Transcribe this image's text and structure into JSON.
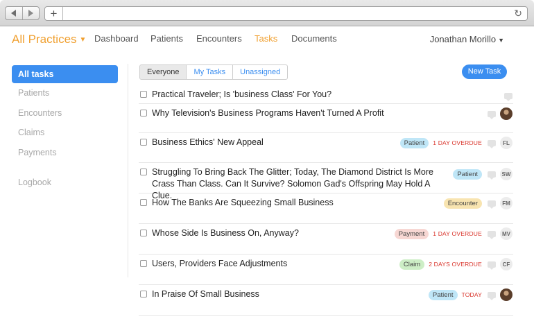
{
  "browser": {
    "url": ""
  },
  "nav": {
    "brand": "All Practices",
    "links": [
      "Dashboard",
      "Patients",
      "Encounters",
      "Tasks",
      "Documents"
    ],
    "active": "Tasks",
    "user": "Jonathan Morillo"
  },
  "sidebar": {
    "items": [
      "All tasks",
      "Patients",
      "Encounters",
      "Claims",
      "Payments"
    ],
    "extra": "Logbook",
    "active": "All tasks"
  },
  "filters": {
    "tabs": [
      "Everyone",
      "My Tasks",
      "Unassigned"
    ],
    "active": "Everyone"
  },
  "new_task_label": "New Task",
  "tasks": [
    {
      "title": "Practical Traveler; Is 'business Class' For You?",
      "tag": "",
      "due": "",
      "assignee": ""
    },
    {
      "title": "Why Television's Business Programs Haven't Turned A Profit",
      "tag": "",
      "due": "",
      "assignee": "photo"
    },
    {
      "title": "Business Ethics' New Appeal",
      "tag": "Patient",
      "due": "1 DAY OVERDUE",
      "assignee": "FL"
    },
    {
      "title": "Struggling To Bring Back The Glitter; Today, The Diamond District Is More Crass Than Class. Can It Survive? Solomon Gad's Offspring May Hold A Clue.",
      "tag": "Patient",
      "due": "",
      "assignee": "SW"
    },
    {
      "title": "How The Banks Are Squeezing Small Business",
      "tag": "Encounter",
      "due": "",
      "assignee": "FM"
    },
    {
      "title": "Whose Side Is Business On, Anyway?",
      "tag": "Payment",
      "due": "1 DAY OVERDUE",
      "assignee": "MV"
    },
    {
      "title": "Users, Providers Face Adjustments",
      "tag": "Claim",
      "due": "2 DAYS OVERDUE",
      "assignee": "CF"
    },
    {
      "title": "In Praise Of Small Business",
      "tag": "Patient",
      "due": "TODAY",
      "assignee": "photo"
    }
  ],
  "colors": {
    "accent": "#3b8ef0",
    "brand": "#f0a030",
    "overdue": "#d9342b"
  }
}
